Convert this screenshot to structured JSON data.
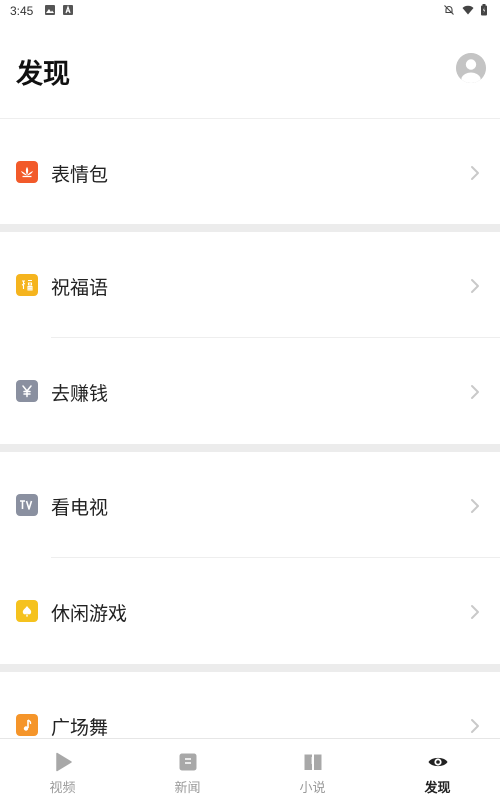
{
  "status_bar": {
    "time": "3:45"
  },
  "header": {
    "title": "发现"
  },
  "groups": [
    {
      "items": [
        {
          "label": "表情包",
          "icon": "lotus-icon",
          "color": "#f25a2a"
        }
      ]
    },
    {
      "items": [
        {
          "label": "祝福语",
          "icon": "blessing-fu-icon",
          "color": "#f5b41e"
        },
        {
          "label": "去赚钱",
          "icon": "yuan-icon",
          "color": "#8a90a0"
        }
      ]
    },
    {
      "items": [
        {
          "label": "看电视",
          "icon": "tv-icon",
          "color": "#8a90a0"
        },
        {
          "label": "休闲游戏",
          "icon": "game-spade-icon",
          "color": "#f5c21e"
        }
      ]
    },
    {
      "items": [
        {
          "label": "广场舞",
          "icon": "music-note-icon",
          "color": "#f5952a"
        }
      ]
    }
  ],
  "bottom_nav": {
    "items": [
      {
        "label": "视频",
        "icon": "play-icon",
        "active": false
      },
      {
        "label": "新闻",
        "icon": "news-icon",
        "active": false
      },
      {
        "label": "小说",
        "icon": "book-icon",
        "active": false
      },
      {
        "label": "发现",
        "icon": "eye-icon",
        "active": true
      }
    ]
  }
}
